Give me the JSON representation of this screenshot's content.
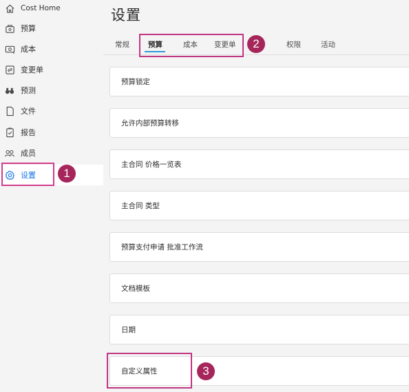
{
  "sidebar": {
    "items": [
      {
        "label": "Cost Home",
        "icon": "home-icon"
      },
      {
        "label": "预算",
        "icon": "budget-icon"
      },
      {
        "label": "成本",
        "icon": "cost-icon"
      },
      {
        "label": "变更单",
        "icon": "change-order-icon"
      },
      {
        "label": "预测",
        "icon": "forecast-icon"
      },
      {
        "label": "文件",
        "icon": "file-icon"
      },
      {
        "label": "报告",
        "icon": "report-icon"
      },
      {
        "label": "成员",
        "icon": "members-icon"
      },
      {
        "label": "设置",
        "icon": "gear-icon"
      }
    ],
    "active_index": 8,
    "active_color": "#1473e6"
  },
  "main": {
    "title": "设置",
    "tabs": [
      {
        "label": "常规"
      },
      {
        "label": "预算"
      },
      {
        "label": "成本"
      },
      {
        "label": "变更单"
      },
      {
        "label": "权限"
      },
      {
        "label": "活动"
      }
    ],
    "active_tab_index": 1,
    "cards": [
      {
        "label": "预算锁定"
      },
      {
        "label": "允许内部预算转移"
      },
      {
        "label": "主合同 价格一览表"
      },
      {
        "label": "主合同 类型"
      },
      {
        "label": "预算支付申请 批准工作流"
      },
      {
        "label": "文档模板"
      },
      {
        "label": "日期"
      },
      {
        "label": "自定义属性"
      }
    ]
  },
  "callouts": [
    {
      "number": "1"
    },
    {
      "number": "2"
    },
    {
      "number": "3"
    }
  ],
  "colors": {
    "callout": "#c13584",
    "badge": "#a6265c",
    "tab_underline": "#2c9ad6"
  }
}
